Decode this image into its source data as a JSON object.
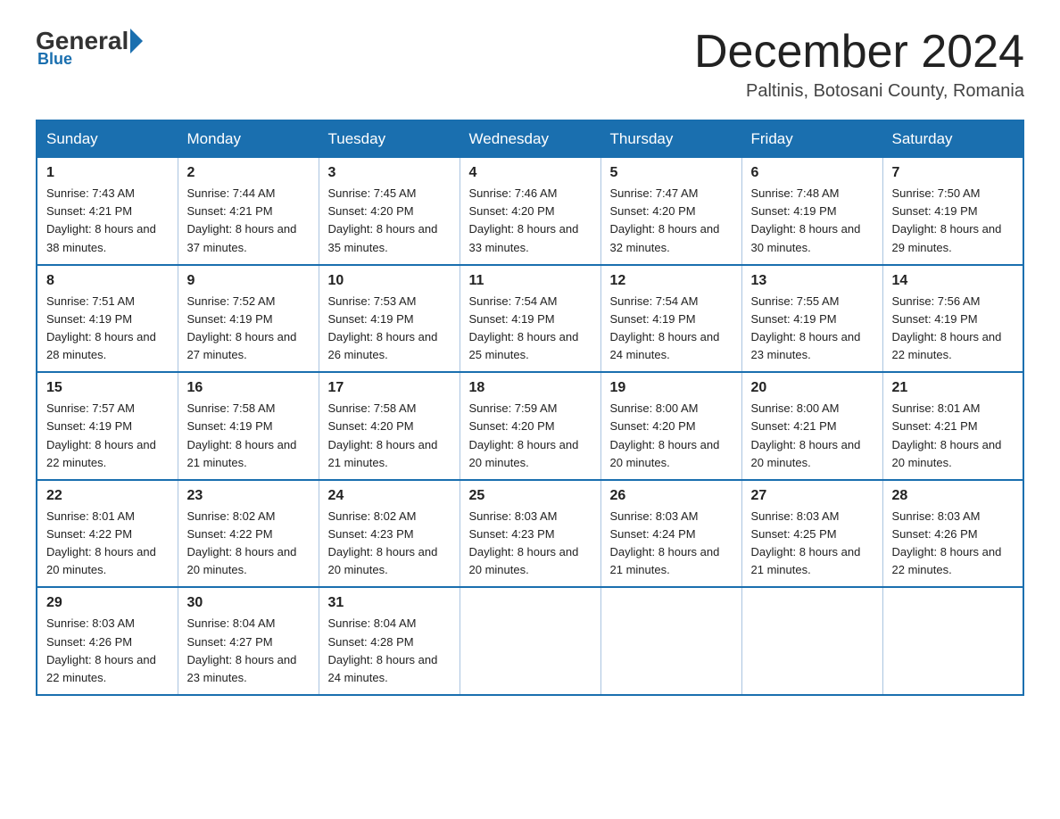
{
  "header": {
    "logo": {
      "general": "General",
      "blue": "Blue"
    },
    "title": "December 2024",
    "location": "Paltinis, Botosani County, Romania"
  },
  "days_of_week": [
    "Sunday",
    "Monday",
    "Tuesday",
    "Wednesday",
    "Thursday",
    "Friday",
    "Saturday"
  ],
  "weeks": [
    [
      {
        "day": "1",
        "sunrise": "7:43 AM",
        "sunset": "4:21 PM",
        "daylight": "8 hours and 38 minutes."
      },
      {
        "day": "2",
        "sunrise": "7:44 AM",
        "sunset": "4:21 PM",
        "daylight": "8 hours and 37 minutes."
      },
      {
        "day": "3",
        "sunrise": "7:45 AM",
        "sunset": "4:20 PM",
        "daylight": "8 hours and 35 minutes."
      },
      {
        "day": "4",
        "sunrise": "7:46 AM",
        "sunset": "4:20 PM",
        "daylight": "8 hours and 33 minutes."
      },
      {
        "day": "5",
        "sunrise": "7:47 AM",
        "sunset": "4:20 PM",
        "daylight": "8 hours and 32 minutes."
      },
      {
        "day": "6",
        "sunrise": "7:48 AM",
        "sunset": "4:19 PM",
        "daylight": "8 hours and 30 minutes."
      },
      {
        "day": "7",
        "sunrise": "7:50 AM",
        "sunset": "4:19 PM",
        "daylight": "8 hours and 29 minutes."
      }
    ],
    [
      {
        "day": "8",
        "sunrise": "7:51 AM",
        "sunset": "4:19 PM",
        "daylight": "8 hours and 28 minutes."
      },
      {
        "day": "9",
        "sunrise": "7:52 AM",
        "sunset": "4:19 PM",
        "daylight": "8 hours and 27 minutes."
      },
      {
        "day": "10",
        "sunrise": "7:53 AM",
        "sunset": "4:19 PM",
        "daylight": "8 hours and 26 minutes."
      },
      {
        "day": "11",
        "sunrise": "7:54 AM",
        "sunset": "4:19 PM",
        "daylight": "8 hours and 25 minutes."
      },
      {
        "day": "12",
        "sunrise": "7:54 AM",
        "sunset": "4:19 PM",
        "daylight": "8 hours and 24 minutes."
      },
      {
        "day": "13",
        "sunrise": "7:55 AM",
        "sunset": "4:19 PM",
        "daylight": "8 hours and 23 minutes."
      },
      {
        "day": "14",
        "sunrise": "7:56 AM",
        "sunset": "4:19 PM",
        "daylight": "8 hours and 22 minutes."
      }
    ],
    [
      {
        "day": "15",
        "sunrise": "7:57 AM",
        "sunset": "4:19 PM",
        "daylight": "8 hours and 22 minutes."
      },
      {
        "day": "16",
        "sunrise": "7:58 AM",
        "sunset": "4:19 PM",
        "daylight": "8 hours and 21 minutes."
      },
      {
        "day": "17",
        "sunrise": "7:58 AM",
        "sunset": "4:20 PM",
        "daylight": "8 hours and 21 minutes."
      },
      {
        "day": "18",
        "sunrise": "7:59 AM",
        "sunset": "4:20 PM",
        "daylight": "8 hours and 20 minutes."
      },
      {
        "day": "19",
        "sunrise": "8:00 AM",
        "sunset": "4:20 PM",
        "daylight": "8 hours and 20 minutes."
      },
      {
        "day": "20",
        "sunrise": "8:00 AM",
        "sunset": "4:21 PM",
        "daylight": "8 hours and 20 minutes."
      },
      {
        "day": "21",
        "sunrise": "8:01 AM",
        "sunset": "4:21 PM",
        "daylight": "8 hours and 20 minutes."
      }
    ],
    [
      {
        "day": "22",
        "sunrise": "8:01 AM",
        "sunset": "4:22 PM",
        "daylight": "8 hours and 20 minutes."
      },
      {
        "day": "23",
        "sunrise": "8:02 AM",
        "sunset": "4:22 PM",
        "daylight": "8 hours and 20 minutes."
      },
      {
        "day": "24",
        "sunrise": "8:02 AM",
        "sunset": "4:23 PM",
        "daylight": "8 hours and 20 minutes."
      },
      {
        "day": "25",
        "sunrise": "8:03 AM",
        "sunset": "4:23 PM",
        "daylight": "8 hours and 20 minutes."
      },
      {
        "day": "26",
        "sunrise": "8:03 AM",
        "sunset": "4:24 PM",
        "daylight": "8 hours and 21 minutes."
      },
      {
        "day": "27",
        "sunrise": "8:03 AM",
        "sunset": "4:25 PM",
        "daylight": "8 hours and 21 minutes."
      },
      {
        "day": "28",
        "sunrise": "8:03 AM",
        "sunset": "4:26 PM",
        "daylight": "8 hours and 22 minutes."
      }
    ],
    [
      {
        "day": "29",
        "sunrise": "8:03 AM",
        "sunset": "4:26 PM",
        "daylight": "8 hours and 22 minutes."
      },
      {
        "day": "30",
        "sunrise": "8:04 AM",
        "sunset": "4:27 PM",
        "daylight": "8 hours and 23 minutes."
      },
      {
        "day": "31",
        "sunrise": "8:04 AM",
        "sunset": "4:28 PM",
        "daylight": "8 hours and 24 minutes."
      },
      null,
      null,
      null,
      null
    ]
  ],
  "labels": {
    "sunrise": "Sunrise:",
    "sunset": "Sunset:",
    "daylight": "Daylight:"
  }
}
